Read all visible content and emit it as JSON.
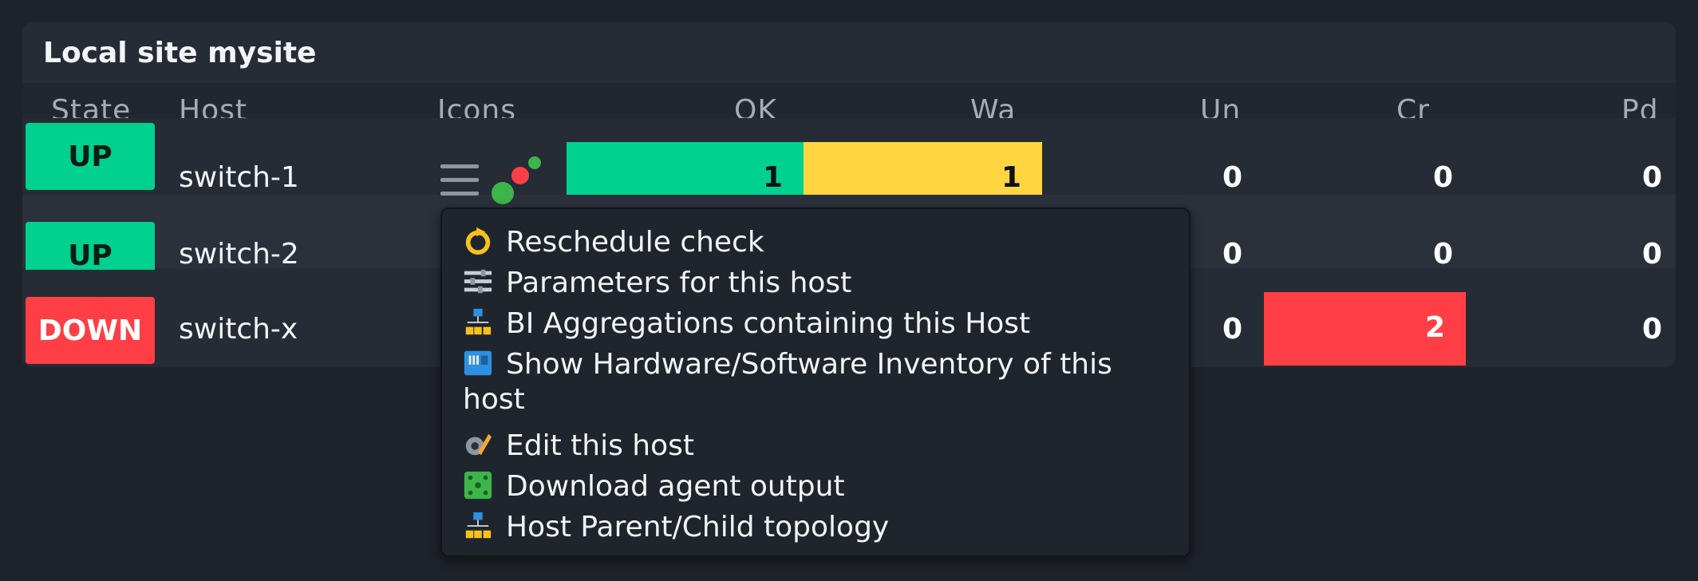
{
  "panel": {
    "title": "Local site mysite"
  },
  "columns": {
    "state": "State",
    "host": "Host",
    "icons": "Icons",
    "ok": "OK",
    "warn": "Wa",
    "unknown": "Un",
    "crit": "Cr",
    "pending": "Pd"
  },
  "rows": [
    {
      "state": "UP",
      "host": "switch-1",
      "ok": "1",
      "warn": "1",
      "unknown": "0",
      "crit": "0",
      "pending": "0"
    },
    {
      "state": "UP",
      "host": "switch-2",
      "unknown": "0",
      "crit": "0",
      "pending": "0"
    },
    {
      "state": "DOWN",
      "host": "switch-x",
      "unknown": "0",
      "crit": "2",
      "pending": "0"
    }
  ],
  "context_menu": {
    "items": [
      {
        "label": "Reschedule check",
        "icon": "reschedule-icon"
      },
      {
        "label": "Parameters for this host",
        "icon": "parameters-icon"
      },
      {
        "label": "BI Aggregations containing this Host",
        "icon": "bi-aggregation-icon"
      },
      {
        "label": "Show Hardware/Software Inventory of this host",
        "icon": "inventory-icon"
      },
      {
        "label": "Edit this host",
        "icon": "edit-host-icon"
      },
      {
        "label": "Download agent output",
        "icon": "agent-output-icon"
      },
      {
        "label": "Host Parent/Child topology",
        "icon": "topology-icon"
      }
    ]
  },
  "colors": {
    "up": "#00d18f",
    "down": "#ff3f45",
    "warn": "#ffd63f",
    "background": "#1e232a",
    "panel": "#262c35"
  }
}
